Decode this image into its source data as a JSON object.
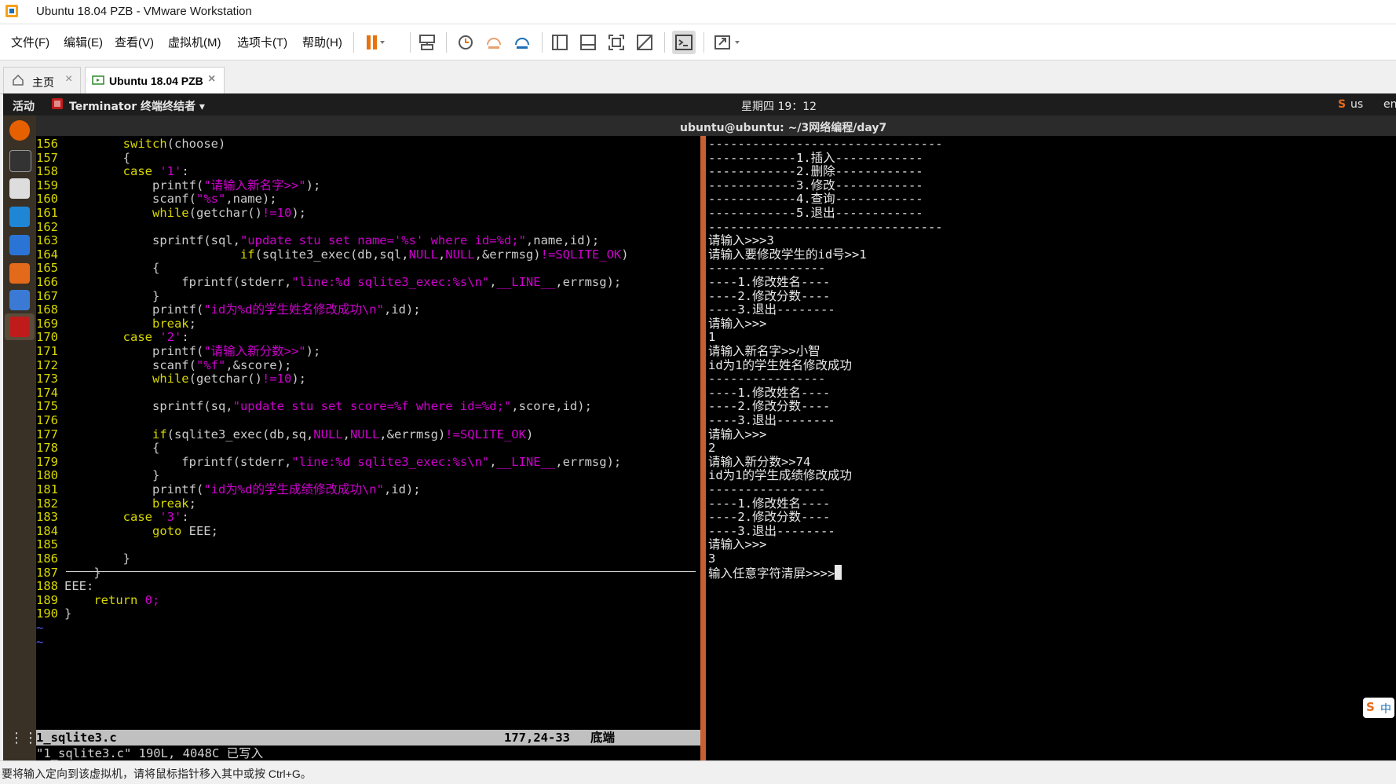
{
  "window": {
    "title": "Ubuntu 18.04 PZB - VMware Workstation"
  },
  "menu": [
    "文件(F)",
    "编辑(E)",
    "查看(V)",
    "虚拟机(M)",
    "选项卡(T)",
    "帮助(H)"
  ],
  "tabs": [
    {
      "label": "主页"
    },
    {
      "label": "Ubuntu 18.04 PZB"
    }
  ],
  "gnome": {
    "activities": "活动",
    "app": "Terminator 终端终结者 ▾",
    "clock": "星期四 19：12",
    "kbd": "us",
    "lang": "en"
  },
  "terminal_title": "ubuntu@ubuntu: ~/3网络编程/day7",
  "vim": {
    "lines": [
      {
        "n": "156",
        "t": "        switch(choose)"
      },
      {
        "n": "157",
        "t": "        {"
      },
      {
        "n": "158",
        "t": "        case '1':"
      },
      {
        "n": "159",
        "t": "            printf(\"请输入新名字>>\");"
      },
      {
        "n": "160",
        "t": "            scanf(\"%s\",name);"
      },
      {
        "n": "161",
        "t": "            while(getchar()!=10);"
      },
      {
        "n": "162",
        "t": ""
      },
      {
        "n": "163",
        "t": "            sprintf(sql,\"update stu set name='%s' where id=%d;\",name,id);"
      },
      {
        "n": "164",
        "t": "                        if(sqlite3_exec(db,sql,NULL,NULL,&errmsg)!=SQLITE_OK)"
      },
      {
        "n": "165",
        "t": "            {"
      },
      {
        "n": "166",
        "t": "                fprintf(stderr,\"line:%d sqlite3_exec:%s\\n\",__LINE__,errmsg);"
      },
      {
        "n": "167",
        "t": "            }"
      },
      {
        "n": "168",
        "t": "            printf(\"id为%d的学生姓名修改成功\\n\",id);"
      },
      {
        "n": "169",
        "t": "            break;"
      },
      {
        "n": "170",
        "t": "        case '2':"
      },
      {
        "n": "171",
        "t": "            printf(\"请输入新分数>>\");"
      },
      {
        "n": "172",
        "t": "            scanf(\"%f\",&score);"
      },
      {
        "n": "173",
        "t": "            while(getchar()!=10);"
      },
      {
        "n": "174",
        "t": ""
      },
      {
        "n": "175",
        "t": "            sprintf(sq,\"update stu set score=%f where id=%d;\",score,id);"
      },
      {
        "n": "176",
        "t": ""
      },
      {
        "n": "177",
        "t": "            if(sqlite3_exec(db,sq,NULL,NULL,&errmsg)!=SQLITE_OK)"
      },
      {
        "n": "178",
        "t": "            {"
      },
      {
        "n": "179",
        "t": "                fprintf(stderr,\"line:%d sqlite3_exec:%s\\n\",__LINE__,errmsg);"
      },
      {
        "n": "180",
        "t": "            }"
      },
      {
        "n": "181",
        "t": "            printf(\"id为%d的学生成绩修改成功\\n\",id);"
      },
      {
        "n": "182",
        "t": "            break;"
      },
      {
        "n": "183",
        "t": "        case '3':"
      },
      {
        "n": "184",
        "t": "            goto EEE;"
      },
      {
        "n": "185",
        "t": ""
      },
      {
        "n": "186",
        "t": "        }"
      },
      {
        "n": "187",
        "t": "    }"
      },
      {
        "n": "188",
        "t": "EEE:"
      },
      {
        "n": "189",
        "t": "    return 0;"
      },
      {
        "n": "190",
        "t": "}"
      }
    ],
    "tildes": [
      "~",
      "~"
    ],
    "status_file": "1_sqlite3.c",
    "status_pos": "177,24-33",
    "status_scroll": "底端",
    "message": "\"1_sqlite3.c\" 190L, 4048C 已写入"
  },
  "right_terminal": [
    "--------------------------------",
    "------------1.插入------------",
    "------------2.删除------------",
    "------------3.修改------------",
    "------------4.查询------------",
    "------------5.退出------------",
    "--------------------------------",
    "请输入>>>3",
    "请输入要修改学生的id号>>1",
    "----------------",
    "----1.修改姓名----",
    "----2.修改分数----",
    "----3.退出--------",
    "请输入>>>",
    "1",
    "请输入新名字>>小智",
    "id为1的学生姓名修改成功",
    "----------------",
    "----1.修改姓名----",
    "----2.修改分数----",
    "----3.退出--------",
    "请输入>>>",
    "2",
    "请输入新分数>>74",
    "id为1的学生成绩修改成功",
    "----------------",
    "----1.修改姓名----",
    "----2.修改分数----",
    "----3.退出--------",
    "请输入>>>",
    "3",
    "输入任意字符清屏>>>>"
  ],
  "statusbar": "要将输入定向到该虚拟机，请将鼠标指针移入其中或按 Ctrl+G。",
  "ime_label": "中"
}
